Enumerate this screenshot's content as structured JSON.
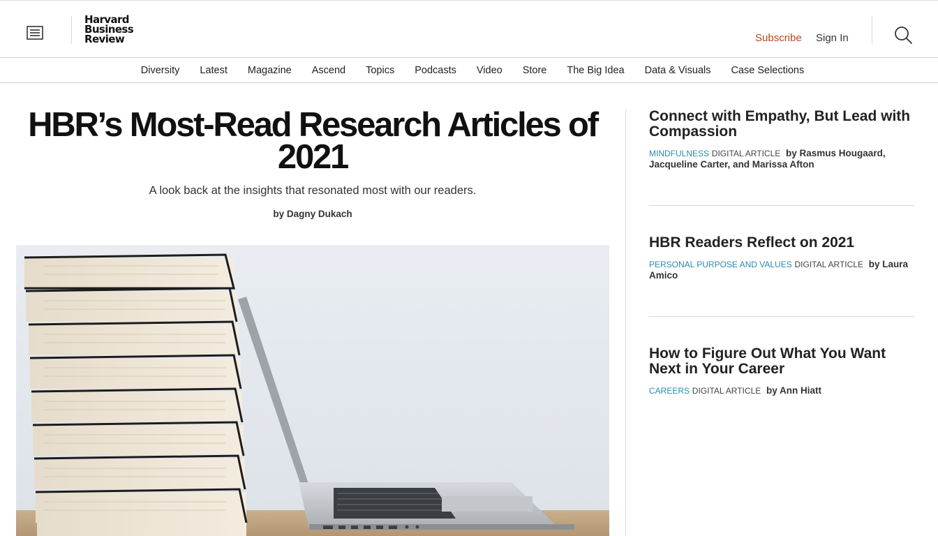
{
  "header": {
    "logo_lines": [
      "Harvard",
      "Business",
      "Review"
    ],
    "subscribe_label": "Subscribe",
    "signin_label": "Sign In",
    "menu_icon": "menu-icon",
    "search_icon": "search-icon",
    "accent_color": "#b8471f"
  },
  "nav": {
    "items": [
      "Diversity",
      "Latest",
      "Magazine",
      "Ascend",
      "Topics",
      "Podcasts",
      "Video",
      "Store",
      "The Big Idea",
      "Data & Visuals",
      "Case Selections"
    ]
  },
  "hero": {
    "title": "HBR’s Most-Read Research Articles of 2021",
    "subtitle": "A look back at the insights that resonated most with our readers.",
    "byline": "by Dagny Dukach"
  },
  "sidebar": {
    "topic_color": "#2a8bb0",
    "articles": [
      {
        "title": "Connect with Empathy, But Lead with Compassion",
        "topic": "MINDFULNESS",
        "kind": "DIGITAL ARTICLE",
        "byline": "by Rasmus Hougaard, Jacqueline Carter, and Marissa Afton"
      },
      {
        "title": "HBR Readers Reflect on 2021",
        "topic": "PERSONAL PURPOSE AND VALUES",
        "kind": "DIGITAL ARTICLE",
        "byline": "by Laura Amico"
      },
      {
        "title": "How to Figure Out What You Want Next in Your Career",
        "topic": "CAREERS",
        "kind": "DIGITAL ARTICLE",
        "byline": "by Ann Hiatt"
      }
    ]
  }
}
